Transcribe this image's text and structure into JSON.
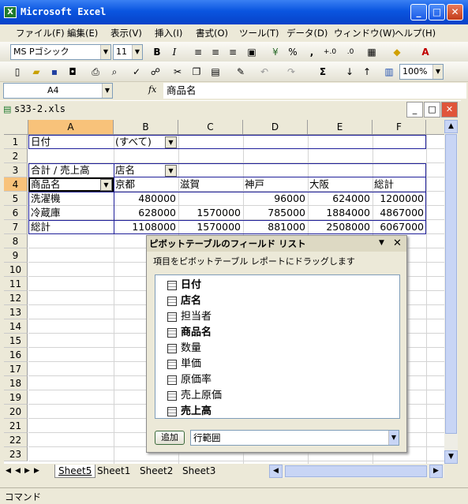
{
  "app": {
    "title": "Microsoft Excel"
  },
  "menu": [
    "ファイル(F)",
    "編集(E)",
    "表示(V)",
    "挿入(I)",
    "書式(O)",
    "ツール(T)",
    "データ(D)",
    "ウィンドウ(W)",
    "ヘルプ(H)"
  ],
  "format_toolbar": {
    "font": "MS Pゴシック",
    "size": "11",
    "bold": "B",
    "italic": "I",
    "percent": "%",
    "comma": ",",
    "inc_decimal": "+.0",
    "dec_decimal": ".0"
  },
  "std_toolbar": {
    "sum": "Σ",
    "zoom": "100%"
  },
  "formula_bar": {
    "name_box": "A4",
    "fx": "fx",
    "content": "商品名"
  },
  "workbook": {
    "title": "s33-2.xls"
  },
  "columns": [
    "A",
    "B",
    "C",
    "D",
    "E",
    "F"
  ],
  "rows": [
    "1",
    "2",
    "3",
    "4",
    "5",
    "6",
    "7",
    "8",
    "9",
    "10",
    "11",
    "12",
    "13",
    "14",
    "15",
    "16",
    "17",
    "18",
    "19",
    "20",
    "21",
    "22",
    "23"
  ],
  "pivot_table": {
    "page_field_label": "日付",
    "page_field_value": "(すべて)",
    "data_label": "合計 / 売上高",
    "col_field": "店名",
    "row_field": "商品名",
    "col_headers": [
      "京都",
      "滋賀",
      "神戸",
      "大阪",
      "総計"
    ],
    "body": [
      {
        "label": "洗濯機",
        "values": [
          "480000",
          "",
          "96000",
          "624000",
          "1200000"
        ]
      },
      {
        "label": "冷蔵庫",
        "values": [
          "628000",
          "1570000",
          "785000",
          "1884000",
          "4867000"
        ]
      },
      {
        "label": "総計",
        "values": [
          "1108000",
          "1570000",
          "881000",
          "2508000",
          "6067000"
        ]
      }
    ]
  },
  "field_list": {
    "title": "ピボットテーブルのフィールド リスト",
    "hint": "項目をピボットテーブル レポートにドラッグします",
    "fields": [
      {
        "name": "日付",
        "bold": true
      },
      {
        "name": "店名",
        "bold": true
      },
      {
        "name": "担当者",
        "bold": false
      },
      {
        "name": "商品名",
        "bold": true
      },
      {
        "name": "数量",
        "bold": false
      },
      {
        "name": "単価",
        "bold": false
      },
      {
        "name": "原価率",
        "bold": false
      },
      {
        "name": "売上原価",
        "bold": false
      },
      {
        "name": "売上高",
        "bold": true
      }
    ],
    "add_button": "追加",
    "area_select": "行範囲"
  },
  "sheets": [
    "Sheet5",
    "Sheet1",
    "Sheet2",
    "Sheet3"
  ],
  "status": "コマンド"
}
